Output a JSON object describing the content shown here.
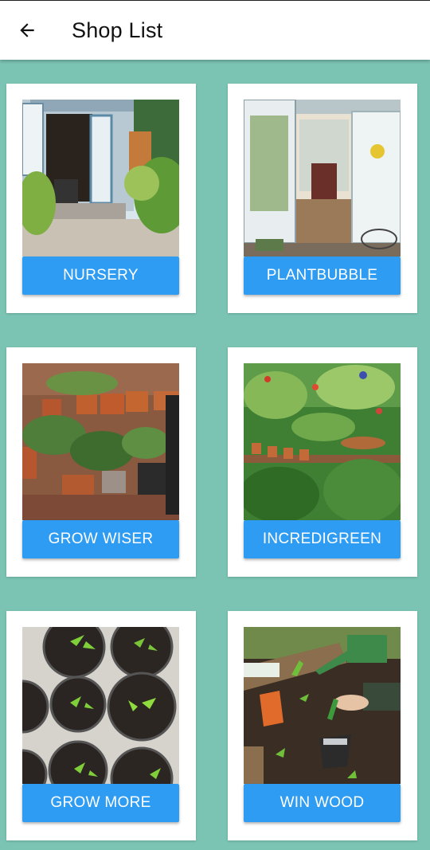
{
  "appbar": {
    "title": "Shop List",
    "back_icon": "arrow-left-icon"
  },
  "shops": [
    {
      "name": "NURSERY"
    },
    {
      "name": "PLANTBUBBLE"
    },
    {
      "name": "GROW WISER"
    },
    {
      "name": "INCREDIGREEN"
    },
    {
      "name": "GROW MORE"
    },
    {
      "name": "WIN WOOD"
    }
  ],
  "colors": {
    "background": "#7bc4b4",
    "button": "#2f9cf4",
    "appbar": "#ffffff"
  }
}
